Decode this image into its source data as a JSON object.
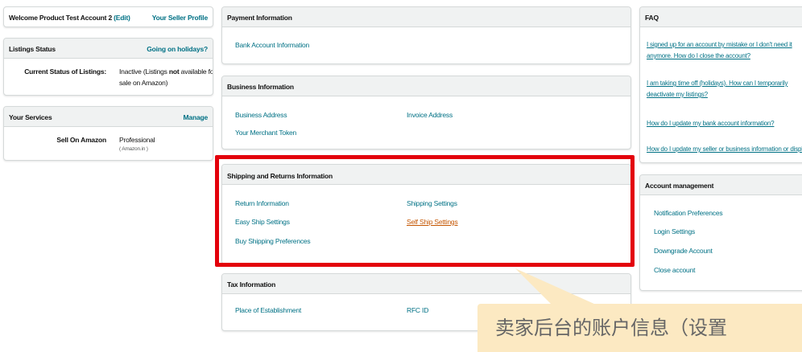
{
  "welcome": {
    "text": "Welcome Product Test Account 2",
    "edit": "(Edit)",
    "seller_profile": "Your Seller Profile"
  },
  "listings": {
    "title": "Listings Status",
    "holiday_link": "Going on holidays?",
    "current_label": "Current Status of Listings:",
    "status_line1_pre": "Inactive (Listings ",
    "status_line1_bold": "not",
    "status_line1_post": " available for",
    "status_line2": "sale on Amazon)"
  },
  "services": {
    "title": "Your Services",
    "manage": "Manage",
    "service_name": "Sell On Amazon",
    "plan": "Professional",
    "marketplace": "( Amazon.in )"
  },
  "payment": {
    "title": "Payment Information",
    "bank": "Bank Account Information"
  },
  "business": {
    "title": "Business Information",
    "address": "Business Address",
    "invoice": "Invoice Address",
    "token": "Your Merchant Token"
  },
  "shipping": {
    "title": "Shipping and Returns Information",
    "return_info": "Return Information",
    "shipping_settings": "Shipping Settings",
    "easy_ship": "Easy Ship Settings",
    "self_ship": "Self Ship Settings",
    "buy_shipping": "Buy Shipping Preferences"
  },
  "tax": {
    "title": "Tax Information",
    "place": "Place of Establishment",
    "rfc": "RFC ID"
  },
  "faq": {
    "title": "FAQ",
    "q1": "I signed up for an account by mistake or I don't need it anymore. How do I close the account?",
    "q2": "I am taking time off (holidays). How can I temporarily deactivate my listings?",
    "q3": "How do I update my bank account information?",
    "q4": "How do I update my seller or business information or display name?"
  },
  "account": {
    "title": "Account management",
    "notifications": "Notification Preferences",
    "login": "Login Settings",
    "downgrade": "Downgrade Account",
    "close": "Close account"
  },
  "annotation": {
    "text": "卖家后台的账户信息（设置"
  },
  "colors": {
    "link": "#007185",
    "active_link": "#c45500",
    "highlight_border": "#e3000b",
    "callout_bg": "#fce9c2"
  }
}
